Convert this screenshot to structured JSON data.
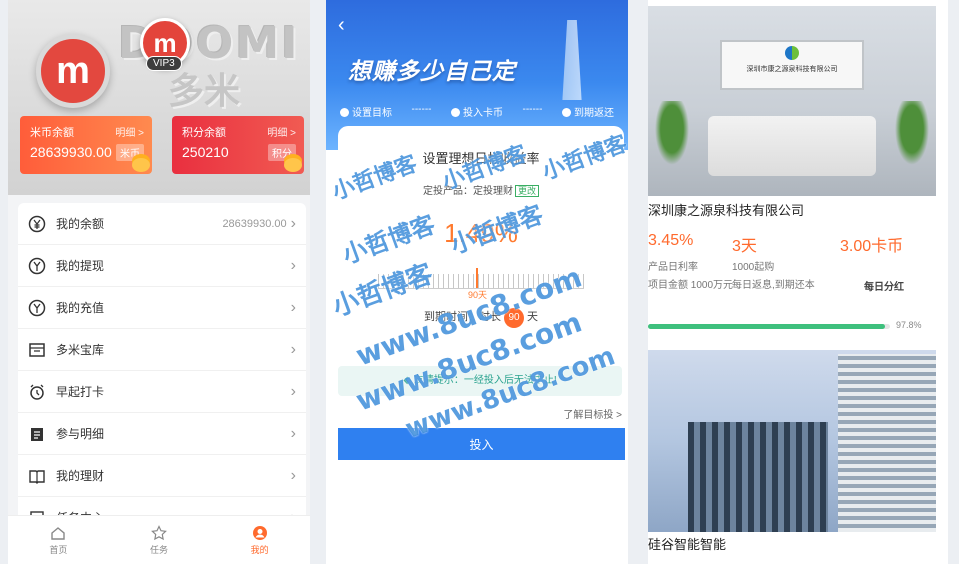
{
  "profile": {
    "brand_latin": "DOOMI",
    "brand_cjk": "多米",
    "logo_letter": "m",
    "vip_badge": "VIP3",
    "cards": [
      {
        "title": "米币余额",
        "detail": "明细 >",
        "value": "28639930.00",
        "tag": "米币"
      },
      {
        "title": "积分余额",
        "detail": "明细 >",
        "value": "250210",
        "tag": "积分"
      }
    ],
    "menu": [
      {
        "label": "我的余额",
        "value": "28639930.00",
        "icon": "yen-circle-icon"
      },
      {
        "label": "我的提现",
        "icon": "withdraw-icon"
      },
      {
        "label": "我的充值",
        "icon": "recharge-icon"
      },
      {
        "label": "多米宝库",
        "icon": "vault-icon"
      },
      {
        "label": "早起打卡",
        "icon": "alarm-clock-icon"
      },
      {
        "label": "参与明细",
        "icon": "clipboard-icon"
      },
      {
        "label": "我的理财",
        "icon": "book-icon"
      },
      {
        "label": "任务中心",
        "icon": "task-icon"
      }
    ],
    "tabs": [
      {
        "label": "首页",
        "icon": "home-icon"
      },
      {
        "label": "任务",
        "icon": "star-icon"
      },
      {
        "label": "我的",
        "icon": "user-icon"
      }
    ]
  },
  "invest": {
    "slogan": "想赚多少自己定",
    "steps": [
      "设置目标",
      "投入卡币",
      "到期返还"
    ],
    "step_separator": "------",
    "heading": "设置理想日标收益率",
    "product_label": "定投产品：",
    "product_name": "定投理财",
    "product_change": "更改",
    "rate": "1.49%",
    "ruler_value": "90天",
    "expiry_prefix": "到期时间：时长",
    "expiry_days": "90",
    "expiry_suffix": "天",
    "tip": "◆ 友情提示：一经投入后无法中止!",
    "learn_more": "了解目标投 >",
    "submit": "投入"
  },
  "products": [
    {
      "company": "深圳康之源泉科技有限公司",
      "sign_text": "深圳市康之源泉科技有限公司",
      "rate": "3.45%",
      "rate_label": "产品日利率",
      "period": "3天",
      "period_label": "1000起购",
      "price": "3.00卡币",
      "amount_label": "项目金额 1000万元",
      "return_label": "每日返息,到期还本",
      "dividend": "每日分红",
      "progress": 97.8,
      "progress_label": "97.8%"
    },
    {
      "company": "硅谷智能智能"
    }
  ],
  "watermark": {
    "cn": "小哲博客",
    "url": "www.8uc8.com"
  },
  "colors": {
    "accent_orange": "#ff6a2d",
    "accent_blue": "#2f80f0",
    "progress_green": "#3ec07d"
  }
}
